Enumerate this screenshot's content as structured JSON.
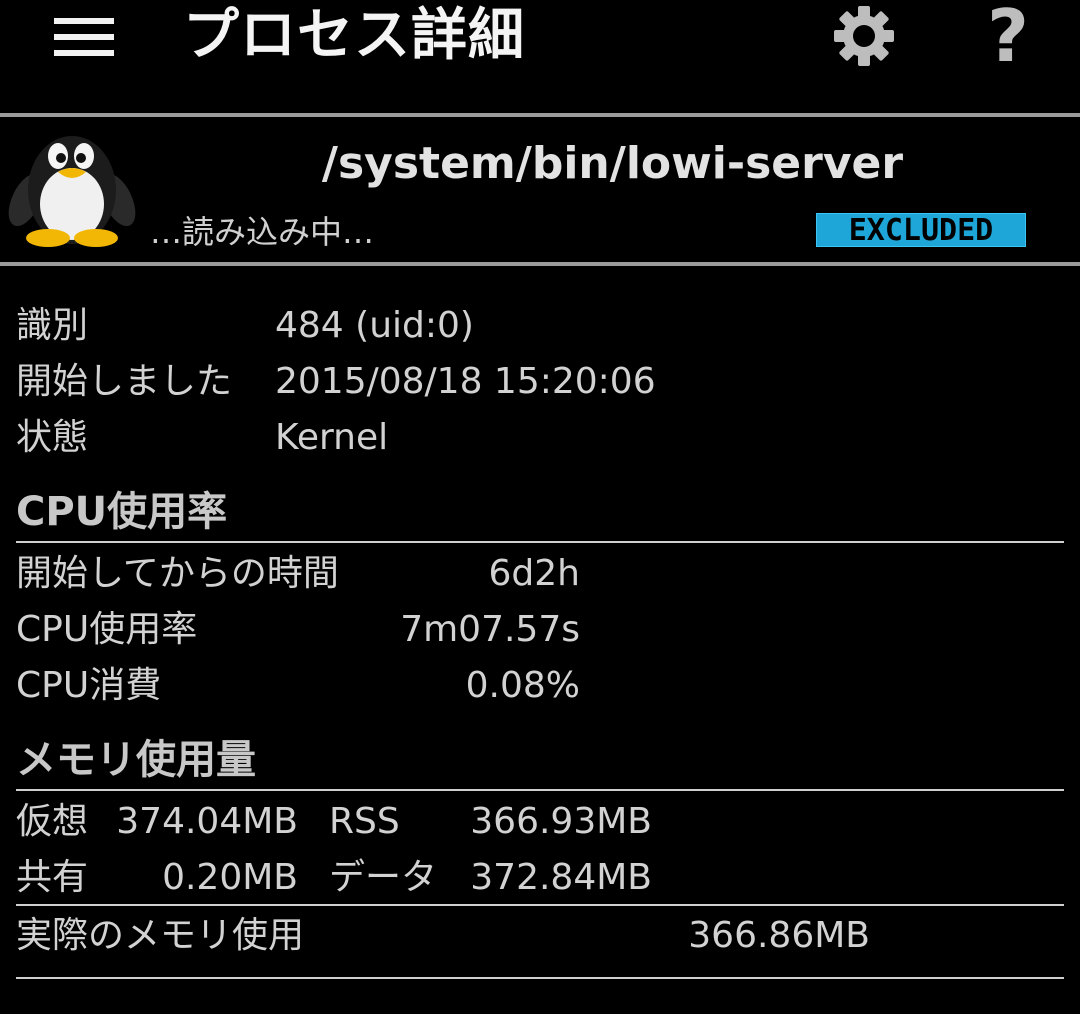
{
  "toolbar": {
    "title": "プロセス詳細",
    "help_label": "?"
  },
  "process": {
    "name": "/system/bin/lowi-server",
    "loading_text": "…読み込み中…",
    "badge": "EXCLUDED",
    "badge_color": "#1fa6d8"
  },
  "info": {
    "id_label": "識別",
    "id_value": "484 (uid:0)",
    "started_label": "開始しました",
    "started_value": "2015/08/18 15:20:06",
    "state_label": "状態",
    "state_value": "Kernel"
  },
  "cpu": {
    "section_title": "CPU使用率",
    "uptime_label": "開始してからの時間",
    "uptime_value": "6d2h",
    "usage_label": "CPU使用率",
    "usage_value": "7m07.57s",
    "consume_label": "CPU消費",
    "consume_value": "0.08%"
  },
  "memory": {
    "section_title": "メモリ使用量",
    "virtual_label": "仮想",
    "virtual_value": "374.04MB",
    "rss_label": "RSS",
    "rss_value": "366.93MB",
    "shared_label": "共有",
    "shared_value": "0.20MB",
    "data_label": "データ",
    "data_value": "372.84MB",
    "actual_label": "実際のメモリ使用",
    "actual_value": "366.86MB"
  }
}
